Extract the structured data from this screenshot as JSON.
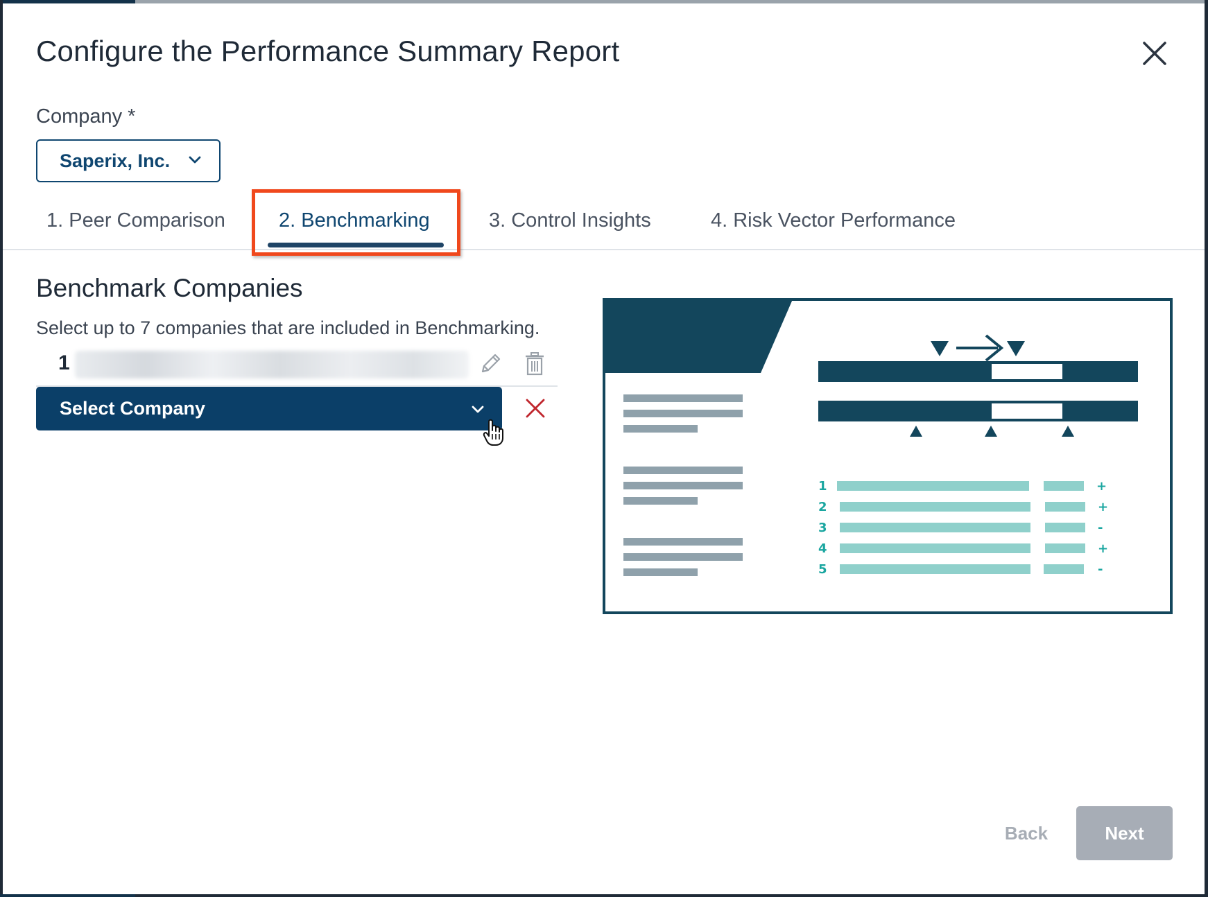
{
  "dialog": {
    "title": "Configure the Performance Summary Report"
  },
  "company": {
    "label": "Company *",
    "selected": "Saperix, Inc."
  },
  "tabs": [
    {
      "label": "1. Peer Comparison",
      "active": false
    },
    {
      "label": "2. Benchmarking",
      "active": true
    },
    {
      "label": "3. Control Insights",
      "active": false
    },
    {
      "label": "4. Risk Vector Performance",
      "active": false
    }
  ],
  "benchmark": {
    "title": "Benchmark Companies",
    "description": "Select up to 7 companies that are included in Benchmarking.",
    "rows": [
      {
        "index": "1"
      }
    ],
    "select_label": "Select Company"
  },
  "preview": {
    "list_numbers": [
      "1",
      "2",
      "3",
      "4",
      "5"
    ],
    "list_signs": [
      "+",
      "+",
      "-",
      "+",
      "-"
    ]
  },
  "footer": {
    "back_label": "Back",
    "next_label": "Next"
  },
  "colors": {
    "primary": "#0b3f68",
    "highlight": "#f0481c",
    "preview_dark": "#13465c",
    "preview_teal": "#8fd0cb",
    "preview_teal_text": "#1aa6a0",
    "danger": "#c0262d",
    "disabled": "#a7adb6"
  },
  "icons": {
    "close": "close-icon",
    "chevron": "chevron-down-icon",
    "edit": "pencil-icon",
    "delete": "trash-icon",
    "remove": "x-icon",
    "cursor": "hand-pointer-icon"
  }
}
